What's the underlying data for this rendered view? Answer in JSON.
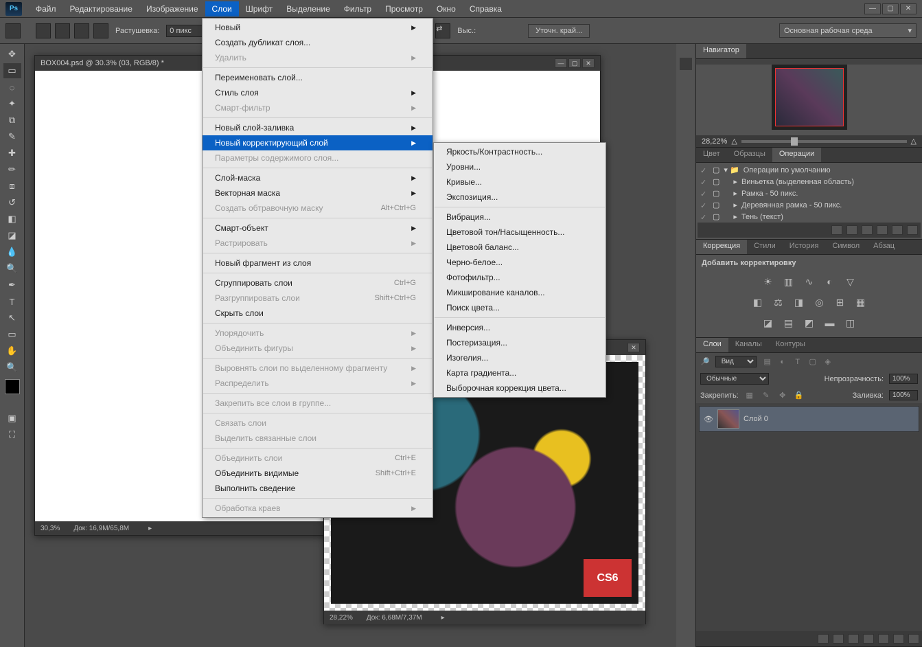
{
  "app": {
    "logo": "Ps"
  },
  "menus": [
    "Файл",
    "Редактирование",
    "Изображение",
    "Слои",
    "Шрифт",
    "Выделение",
    "Фильтр",
    "Просмотр",
    "Окно",
    "Справка"
  ],
  "active_menu_index": 3,
  "options": {
    "feather_label": "Растушевка:",
    "feather_value": "0 пикс",
    "refine_label": "Уточн. край...",
    "size_label": "Выс.:",
    "workspace": "Основная рабочая среда"
  },
  "doc1": {
    "title": "BOX004.psd @ 30.3% (03, RGB/8) *",
    "zoom": "30,3%",
    "docsize": "Док: 16,9M/65,8M"
  },
  "doc2": {
    "zoom": "28,22%",
    "docsize": "Док: 6,68M/7,37M"
  },
  "navigator": {
    "tab": "Навигатор",
    "zoom": "28,22%"
  },
  "color_panel": {
    "tabs": [
      "Цвет",
      "Образцы",
      "Операции"
    ],
    "active": 2
  },
  "actions": {
    "set": "Операции по умолчанию",
    "items": [
      "Виньетка (выделенная область)",
      "Рамка - 50 пикс.",
      "Деревянная рамка - 50 пикс.",
      "Тень (текст)"
    ]
  },
  "adjustments_panel": {
    "tabs": [
      "Коррекция",
      "Стили",
      "История",
      "Символ",
      "Абзац"
    ],
    "title": "Добавить корректировку"
  },
  "layers_panel": {
    "tabs": [
      "Слои",
      "Каналы",
      "Контуры"
    ],
    "kind_label": "Вид",
    "blend_mode": "Обычные",
    "opacity_label": "Непрозрачность:",
    "opacity_value": "100%",
    "lock_label": "Закрепить:",
    "fill_label": "Заливка:",
    "fill_value": "100%",
    "layer0": "Слой 0"
  },
  "layer_menu": [
    {
      "t": "Новый",
      "arrow": true
    },
    {
      "t": "Создать дубликат слоя..."
    },
    {
      "t": "Удалить",
      "arrow": true,
      "disabled": true
    },
    {
      "sep": true
    },
    {
      "t": "Переименовать слой..."
    },
    {
      "t": "Стиль слоя",
      "arrow": true
    },
    {
      "t": "Смарт-фильтр",
      "arrow": true,
      "disabled": true
    },
    {
      "sep": true
    },
    {
      "t": "Новый слой-заливка",
      "arrow": true
    },
    {
      "t": "Новый корректирующий слой",
      "arrow": true,
      "hl": true
    },
    {
      "t": "Параметры содержимого слоя...",
      "disabled": true
    },
    {
      "sep": true
    },
    {
      "t": "Слой-маска",
      "arrow": true
    },
    {
      "t": "Векторная маска",
      "arrow": true
    },
    {
      "t": "Создать обтравочную маску",
      "sc": "Alt+Ctrl+G",
      "disabled": true
    },
    {
      "sep": true
    },
    {
      "t": "Смарт-объект",
      "arrow": true
    },
    {
      "t": "Растрировать",
      "arrow": true,
      "disabled": true
    },
    {
      "sep": true
    },
    {
      "t": "Новый фрагмент из слоя"
    },
    {
      "sep": true
    },
    {
      "t": "Сгруппировать слои",
      "sc": "Ctrl+G"
    },
    {
      "t": "Разгруппировать слои",
      "sc": "Shift+Ctrl+G",
      "disabled": true
    },
    {
      "t": "Скрыть слои"
    },
    {
      "sep": true
    },
    {
      "t": "Упорядочить",
      "arrow": true,
      "disabled": true
    },
    {
      "t": "Объединить фигуры",
      "arrow": true,
      "disabled": true
    },
    {
      "sep": true
    },
    {
      "t": "Выровнять слои по выделенному фрагменту",
      "arrow": true,
      "disabled": true
    },
    {
      "t": "Распределить",
      "arrow": true,
      "disabled": true
    },
    {
      "sep": true
    },
    {
      "t": "Закрепить все слои в группе...",
      "disabled": true
    },
    {
      "sep": true
    },
    {
      "t": "Связать слои",
      "disabled": true
    },
    {
      "t": "Выделить связанные слои",
      "disabled": true
    },
    {
      "sep": true
    },
    {
      "t": "Объединить слои",
      "sc": "Ctrl+E",
      "disabled": true
    },
    {
      "t": "Объединить видимые",
      "sc": "Shift+Ctrl+E"
    },
    {
      "t": "Выполнить сведение"
    },
    {
      "sep": true
    },
    {
      "t": "Обработка краев",
      "arrow": true,
      "disabled": true
    }
  ],
  "adj_submenu": [
    {
      "t": "Яркость/Контрастность..."
    },
    {
      "t": "Уровни..."
    },
    {
      "t": "Кривые..."
    },
    {
      "t": "Экспозиция..."
    },
    {
      "sep": true
    },
    {
      "t": "Вибрация..."
    },
    {
      "t": "Цветовой тон/Насыщенность..."
    },
    {
      "t": "Цветовой баланс..."
    },
    {
      "t": "Черно-белое..."
    },
    {
      "t": "Фотофильтр..."
    },
    {
      "t": "Микширование каналов..."
    },
    {
      "t": "Поиск цвета..."
    },
    {
      "sep": true
    },
    {
      "t": "Инверсия..."
    },
    {
      "t": "Постеризация..."
    },
    {
      "t": "Изогелия..."
    },
    {
      "t": "Карта градиента..."
    },
    {
      "t": "Выборочная коррекция цвета..."
    }
  ]
}
